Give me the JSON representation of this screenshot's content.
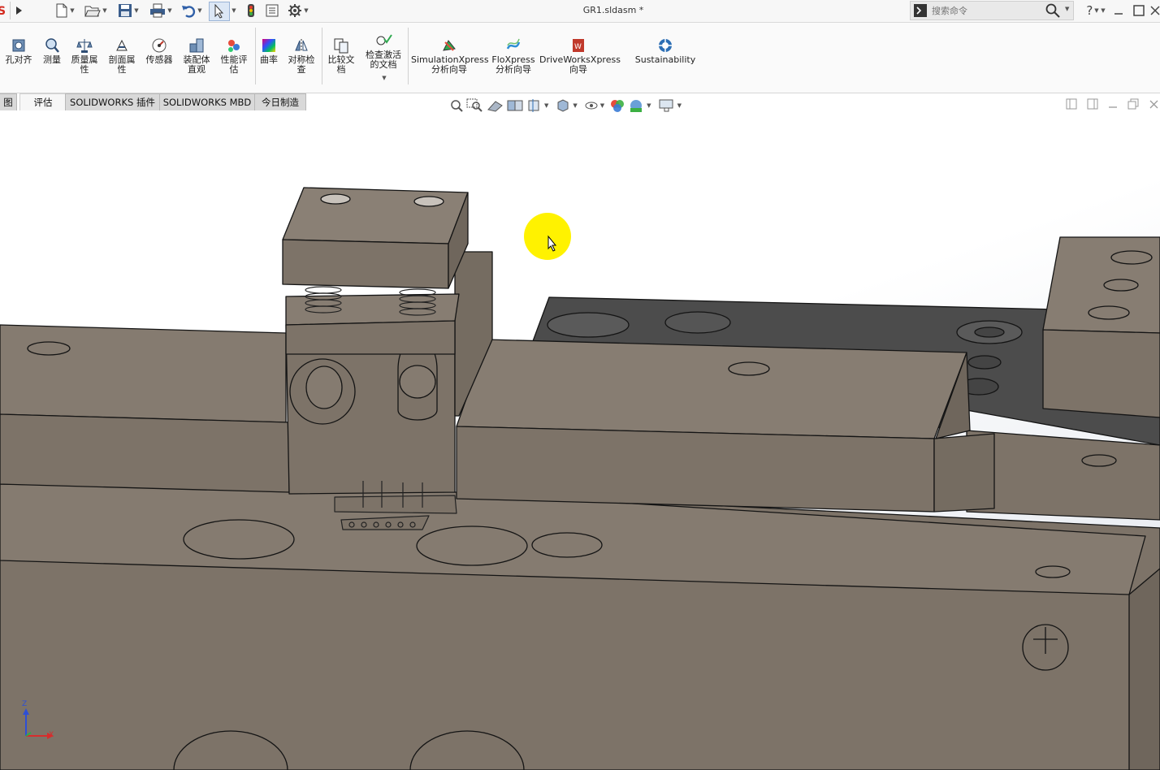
{
  "app": {
    "document_title": "GR1.sldasm *"
  },
  "search": {
    "placeholder": "搜索命令"
  },
  "tools": [
    {
      "label": "孔对齐",
      "icon": "hole-align-icon"
    },
    {
      "label": "测量",
      "icon": "measure-icon"
    },
    {
      "label": "质量属性",
      "icon": "mass-properties-icon"
    },
    {
      "label": "剖面属性",
      "icon": "section-properties-icon"
    },
    {
      "label": "传感器",
      "icon": "sensor-icon"
    },
    {
      "label": "装配体直观",
      "icon": "assembly-visualization-icon"
    },
    {
      "label": "性能评估",
      "icon": "performance-evaluation-icon"
    },
    {
      "label": "曲率",
      "icon": "curvature-icon"
    },
    {
      "label": "对称检查",
      "icon": "symmetry-check-icon"
    },
    {
      "label": "比较文档",
      "icon": "compare-documents-icon"
    },
    {
      "label": "检查激活的文档",
      "icon": "check-active-document-icon"
    },
    {
      "label": "SimulationXpress 分析向导",
      "icon": "simulationxpress-icon"
    },
    {
      "label": "FloXpress 分析向导",
      "icon": "floxpress-icon"
    },
    {
      "label": "DriveWorksXpress 向导",
      "icon": "driveworksxpress-icon"
    },
    {
      "label": "Sustainability",
      "icon": "sustainability-icon"
    }
  ],
  "tabs": [
    {
      "label": "图"
    },
    {
      "label": "评估"
    },
    {
      "label": "SOLIDWORKS 插件"
    },
    {
      "label": "SOLIDWORKS MBD"
    },
    {
      "label": "今日制造"
    }
  ],
  "triad": {
    "z_label": "Z",
    "x_label": "X"
  },
  "colors": {
    "part_fill": "#7d7368",
    "part_top": "#8a8075",
    "dark_part": "#4a4a4a",
    "cursor_highlight": "#fff200"
  }
}
